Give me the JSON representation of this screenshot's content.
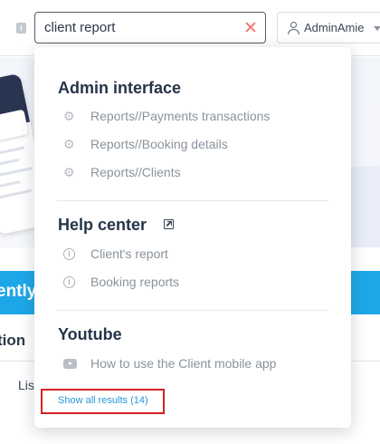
{
  "header": {
    "search": {
      "value": "client report",
      "placeholder": ""
    },
    "user": {
      "name": "AdminAmie"
    }
  },
  "background": {
    "banner_text": "ently a",
    "section_heading": "tion",
    "list_text": "Lis"
  },
  "dropdown": {
    "groups": [
      {
        "title": "Admin interface",
        "icon": "gear-icon",
        "items": [
          {
            "label": "Reports//Payments transactions"
          },
          {
            "label": "Reports//Booking details"
          },
          {
            "label": "Reports//Clients"
          }
        ]
      },
      {
        "title": "Help center",
        "title_icon": "external-link-icon",
        "icon": "info-icon",
        "items": [
          {
            "label": "Client's report"
          },
          {
            "label": "Booking reports"
          }
        ]
      },
      {
        "title": "Youtube",
        "icon": "youtube-icon",
        "items": [
          {
            "label": "How to use the Client mobile app"
          }
        ]
      }
    ],
    "show_all": "Show all results (14)"
  },
  "colors": {
    "accent_blue": "#1ea7e8",
    "link_blue": "#2596d9",
    "highlight_red": "#d42222",
    "clear_icon": "#ef7b6e"
  }
}
